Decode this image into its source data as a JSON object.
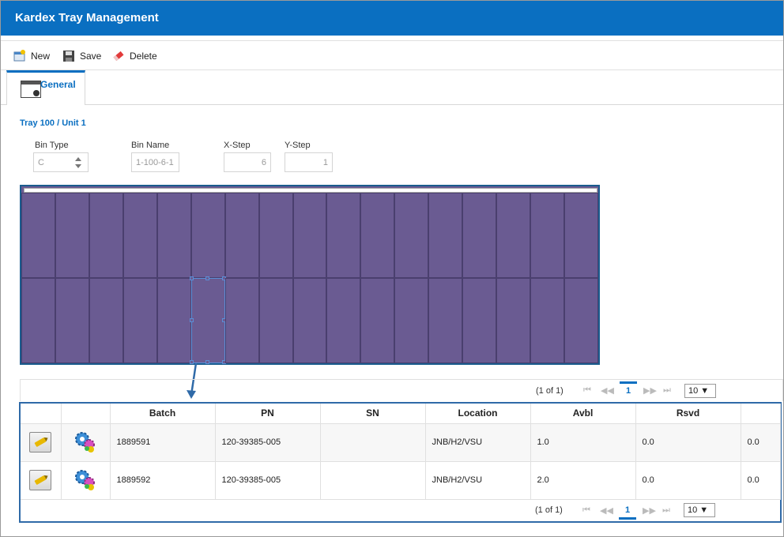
{
  "window": {
    "title": "Kardex Tray Management"
  },
  "toolbar": {
    "new_label": "New",
    "save_label": "Save",
    "delete_label": "Delete"
  },
  "tabs": [
    {
      "label": "General"
    }
  ],
  "breadcrumb": "Tray 100 / Unit 1",
  "fields": {
    "bin_type": {
      "label": "Bin Type",
      "value": "C"
    },
    "bin_name": {
      "label": "Bin Name",
      "value": "1-100-6-1"
    },
    "x_step": {
      "label": "X-Step",
      "value": "6"
    },
    "y_step": {
      "label": "Y-Step",
      "value": "1"
    }
  },
  "tray": {
    "columns": 17,
    "rows": 2,
    "selected_bin": {
      "column": 6,
      "row": 2
    },
    "color": "#6a5b92"
  },
  "pager": {
    "summary": "(1 of 1)",
    "current_page": "1",
    "page_size": "10 ▼"
  },
  "grid": {
    "columns": [
      "",
      "",
      "Batch",
      "PN",
      "SN",
      "Location",
      "Avbl",
      "Rsvd",
      ""
    ],
    "rows": [
      {
        "batch": "1889591",
        "pn": "120-39385-005",
        "sn": "",
        "location": "JNB/H2/VSU",
        "avbl": "1.0",
        "rsvd": "0.0",
        "extra": "0.0"
      },
      {
        "batch": "1889592",
        "pn": "120-39385-005",
        "sn": "",
        "location": "JNB/H2/VSU",
        "avbl": "2.0",
        "rsvd": "0.0",
        "extra": "0.0"
      }
    ]
  },
  "colors": {
    "accent": "#0a6fc1",
    "tray_fill": "#6a5b92",
    "highlight_border": "#2f6aa8"
  }
}
